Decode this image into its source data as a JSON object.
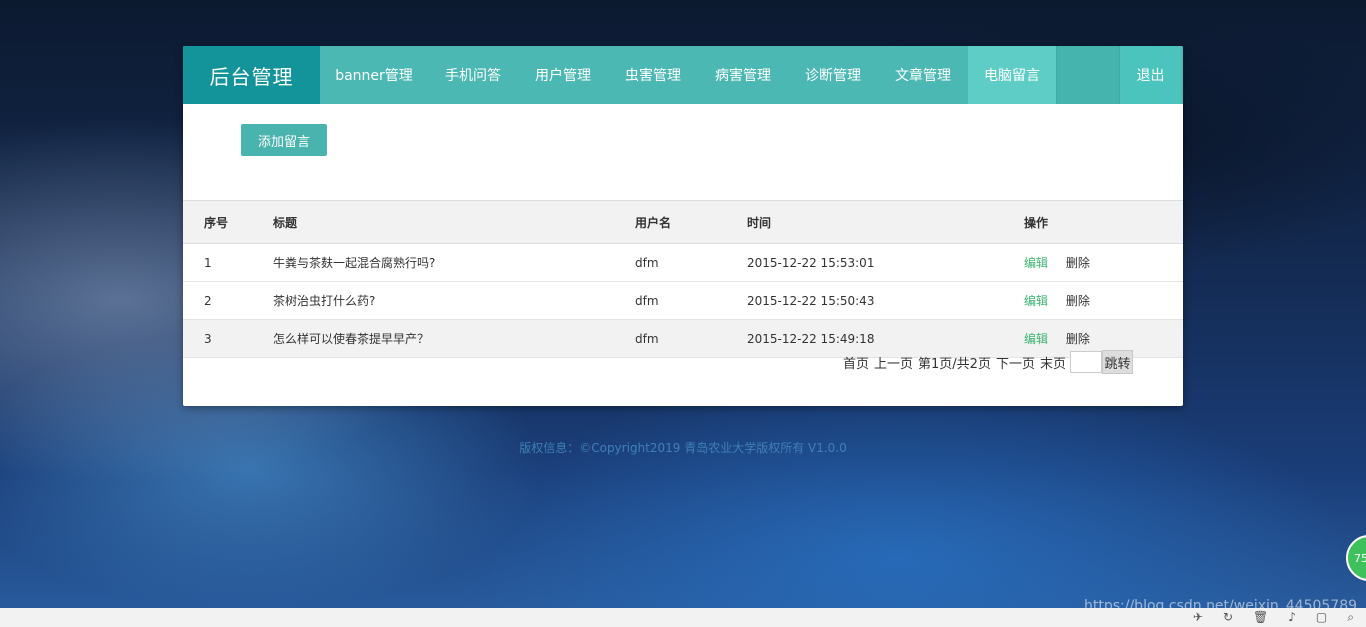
{
  "navbar": {
    "brand": "后台管理",
    "items": [
      {
        "label": "banner管理"
      },
      {
        "label": "手机问答"
      },
      {
        "label": "用户管理"
      },
      {
        "label": "虫害管理"
      },
      {
        "label": "病害管理"
      },
      {
        "label": "诊断管理"
      },
      {
        "label": "文章管理"
      },
      {
        "label": "电脑留言",
        "active": true
      }
    ],
    "logout": "退出"
  },
  "toolbar": {
    "add_label": "添加留言"
  },
  "table": {
    "headers": [
      "序号",
      "标题",
      "用户名",
      "时间",
      "操作"
    ],
    "rows": [
      {
        "no": "1",
        "title": "牛粪与茶麸一起混合腐熟行吗?",
        "user": "dfm",
        "time": "2015-12-22 15:53:01"
      },
      {
        "no": "2",
        "title": "茶树治虫打什么药?",
        "user": "dfm",
        "time": "2015-12-22 15:50:43"
      },
      {
        "no": "3",
        "title": "怎么样可以使春茶提早早产？",
        "user": "dfm",
        "time": "2015-12-22 15:49:18"
      }
    ],
    "edit_label": "编辑",
    "delete_label": "删除"
  },
  "pager": {
    "first": "首页",
    "prev": "上一页",
    "info": "第1页/共2页",
    "next": "下一页",
    "last": "末页",
    "input_value": "",
    "jump": "跳转"
  },
  "footer": {
    "copyright": "版权信息：©Copyright2019 青岛农业大学版权所有 V1.0.0"
  },
  "overlay": {
    "badge": "75",
    "watermark": "https://blog.csdn.net/weixin_44505789"
  },
  "colors": {
    "brand_bg": "#13949a",
    "nav_bg": "#4bb8b3",
    "nav_active": "#5ecdc6",
    "edit_link": "#3cb371"
  }
}
